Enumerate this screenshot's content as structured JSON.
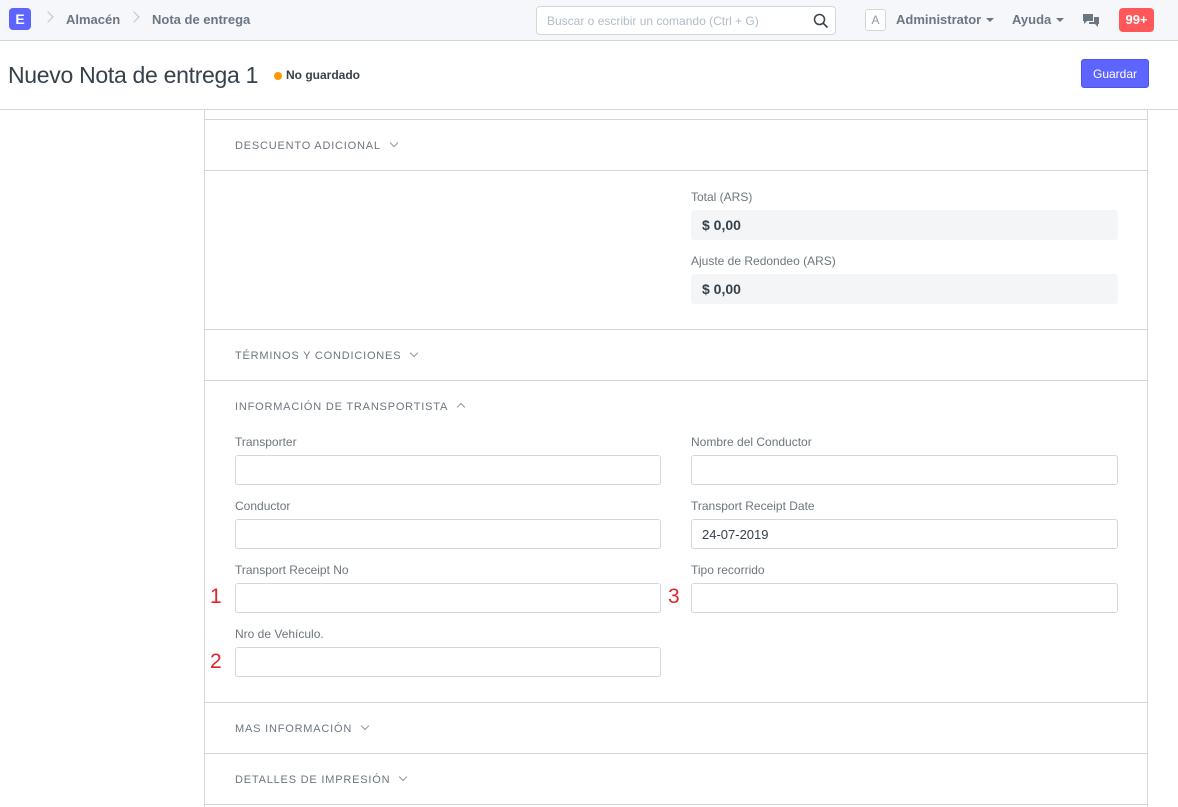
{
  "navbar": {
    "brand_letter": "E",
    "breadcrumbs": [
      "Almacén",
      "Nota de entrega"
    ],
    "search_placeholder": "Buscar o escribir un comando (Ctrl + G)",
    "avatar_letter": "A",
    "user_menu": "Administrator",
    "help_menu": "Ayuda",
    "notifications_count": "99+"
  },
  "page": {
    "title": "Nuevo Nota de entrega 1",
    "status": "No guardado",
    "save_label": "Guardar"
  },
  "sections": {
    "additional_discount": "DESCUENTO ADICIONAL",
    "terms": "TÉRMINOS Y CONDICIONES",
    "transporter_info": "INFORMACIÓN DE TRANSPORTISTA",
    "more_info": "MAS INFORMACIÓN",
    "print_details": "DETALLES DE IMPRESIÓN"
  },
  "totals": {
    "total_label": "Total (ARS)",
    "total_value": "$ 0,00",
    "rounding_label": "Ajuste de Redondeo (ARS)",
    "rounding_value": "$ 0,00"
  },
  "transport": {
    "transporter_label": "Transporter",
    "transporter_value": "",
    "driver_name_label": "Nombre del Conductor",
    "driver_name_value": "",
    "driver_label": "Conductor",
    "driver_value": "",
    "receipt_date_label": "Transport Receipt Date",
    "receipt_date_value": "24-07-2019",
    "receipt_no_label": "Transport Receipt No",
    "receipt_no_value": "",
    "route_type_label": "Tipo recorrido",
    "route_type_value": "",
    "vehicle_no_label": "Nro de Vehículo.",
    "vehicle_no_value": ""
  },
  "annotations": [
    "1",
    "2",
    "3"
  ],
  "colors": {
    "primary": "#5e64ff",
    "badge": "#ff5858",
    "unsaved_dot": "#ff9800",
    "annotation": "#e0242a"
  }
}
